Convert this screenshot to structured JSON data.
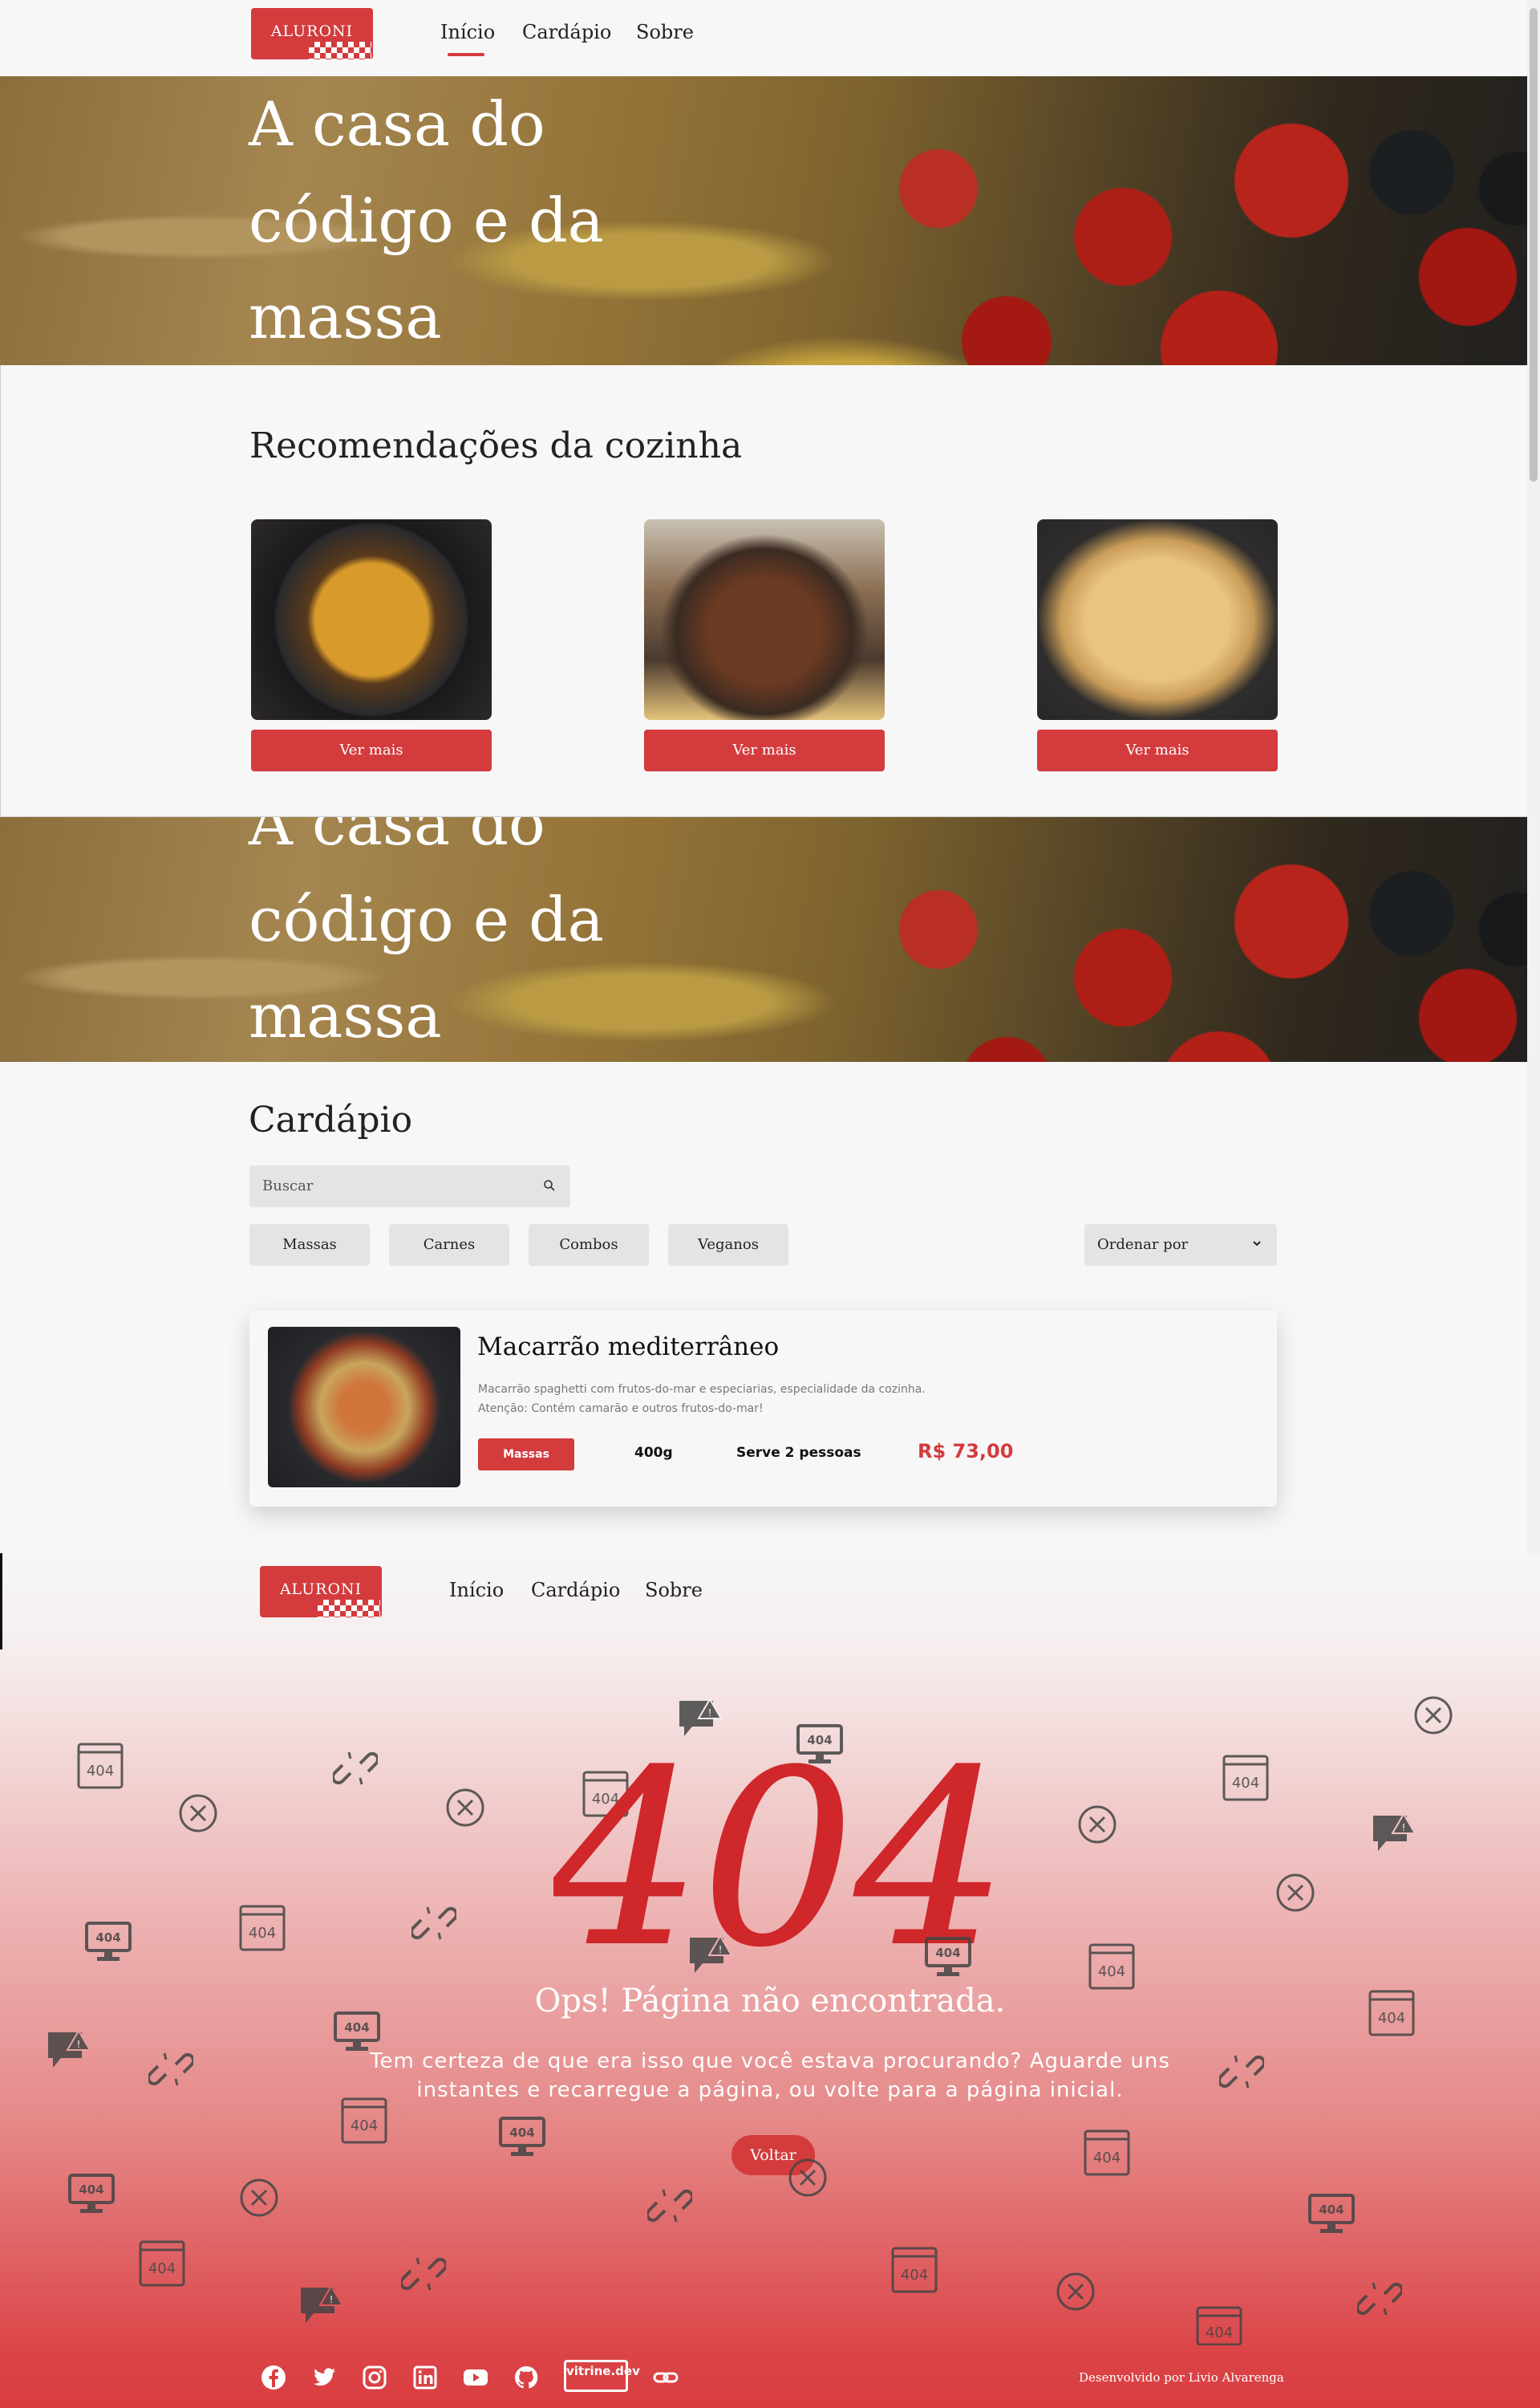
{
  "brand": {
    "logo_text": "ALURONI",
    "accent": "#d33b3d"
  },
  "nav": {
    "items": [
      "Início",
      "Cardápio",
      "Sobre"
    ]
  },
  "hero": {
    "title": "A casa do código e da massa"
  },
  "recommendations": {
    "title": "Recomendações da cozinha",
    "cards": [
      {
        "button": "Ver mais"
      },
      {
        "button": "Ver mais"
      },
      {
        "button": "Ver mais"
      }
    ]
  },
  "menu": {
    "title": "Cardápio",
    "search_placeholder": "Buscar",
    "filters": [
      "Massas",
      "Carnes",
      "Combos",
      "Veganos"
    ],
    "order_label": "Ordenar por",
    "dish": {
      "name": "Macarrão mediterrâneo",
      "desc_line1": "Macarrão spaghetti com frutos-do-mar e especiarias, especialidade da cozinha.",
      "desc_line2": "Atenção: Contém camarão e outros frutos-do-mar!",
      "category": "Massas",
      "size": "400g",
      "serves": "Serve 2 pessoas",
      "price": "R$ 73,00"
    }
  },
  "not_found": {
    "code": "404",
    "heading": "Ops! Página não encontrada.",
    "message": "Tem certeza de que era isso que você estava procurando? Aguarde uns instantes e recarregue a página, ou volte para a página inicial.",
    "button": "Voltar"
  },
  "footer": {
    "credit_prefix": "Desenvolvido por",
    "credit_name": "Livio Alvarenga",
    "social_icons": [
      "facebook-icon",
      "twitter-icon",
      "instagram-icon",
      "linkedin-icon",
      "youtube-icon",
      "github-icon",
      "vitrine-dev-icon",
      "link-icon"
    ],
    "vitrine_label": "vitrine.dev"
  }
}
